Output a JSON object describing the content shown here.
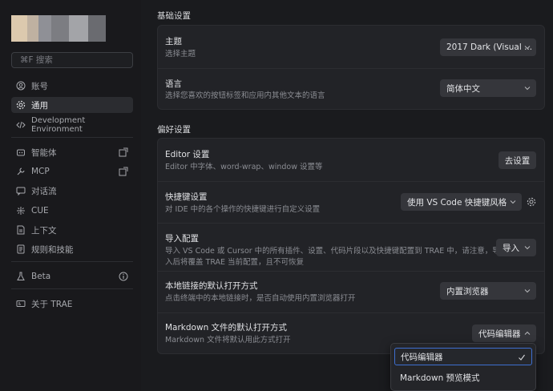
{
  "sidebar": {
    "search_placeholder": "⌘F 搜索",
    "avatar_colors": [
      "#d6c2a8",
      "#c9b39a",
      "#9a9aa0",
      "#8e8f94",
      "#a8a9ad",
      "#6e6f74"
    ],
    "items": [
      {
        "label": "账号",
        "icon": "user-icon"
      },
      {
        "label": "通用",
        "icon": "gear-icon",
        "active": true
      },
      {
        "label": "Development Environment",
        "icon": "code-icon"
      },
      {
        "label": "智能体",
        "icon": "robot-icon"
      },
      {
        "label": "MCP",
        "icon": "wrench-icon"
      },
      {
        "label": "对话流",
        "icon": "chat-icon"
      },
      {
        "label": "CUE",
        "icon": "sparkle-icon"
      },
      {
        "label": "上下文",
        "icon": "document-icon"
      },
      {
        "label": "规则和技能",
        "icon": "book-icon"
      },
      {
        "label": "Beta",
        "icon": "flask-icon"
      },
      {
        "label": "关于 TRAE",
        "icon": "info-card-icon"
      }
    ]
  },
  "main": {
    "basic_title": "基础设置",
    "pref_title": "偏好设置",
    "basic": {
      "theme": {
        "title": "主题",
        "desc": "选择主题",
        "value": "2017 Dark (Visual ..."
      },
      "language": {
        "title": "语言",
        "desc": "选择您喜欢的按钮标签和应用内其他文本的语言",
        "value": "简体中文"
      }
    },
    "pref": {
      "editor": {
        "title": "Editor 设置",
        "desc": "Editor 中字体、word-wrap、window 设置等",
        "button": "去设置"
      },
      "shortcut": {
        "title": "快捷键设置",
        "desc": "对 IDE 中的各个操作的快捷键进行自定义设置",
        "value": "使用 VS Code 快捷键风格"
      },
      "import": {
        "title": "导入配置",
        "desc_line1": "导入 VS Code 或 Cursor 中的所有插件、设置、代码片段以及快捷键配置到 TRAE 中，请注意，导",
        "desc_line2": "入后将覆盖 TRAE 当前配置，且不可恢复",
        "value": "导入"
      },
      "link": {
        "title": "本地链接的默认打开方式",
        "desc": "点击终端中的本地链接时，是否自动使用内置浏览器打开",
        "value": "内置浏览器"
      },
      "markdown": {
        "title": "Markdown 文件的默认打开方式",
        "desc": "Markdown 文件将默认用此方式打开",
        "value": "代码编辑器"
      }
    }
  },
  "dropdown": {
    "options": [
      "代码编辑器",
      "Markdown 预览模式"
    ],
    "selected": "代码编辑器",
    "accent": "#3e6fd0"
  }
}
